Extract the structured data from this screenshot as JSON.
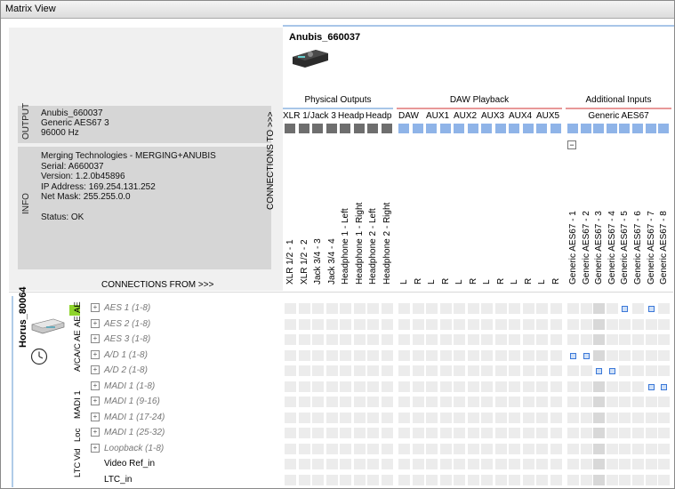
{
  "window": {
    "title": "Matrix View"
  },
  "output_panel": {
    "section_label": "OUTPUT",
    "name": "Anubis_660037",
    "type": "Generic AES67 3",
    "rate": "96000 Hz"
  },
  "info_panel": {
    "section_label": "INFO",
    "lines": [
      "Merging Technologies - MERGING+ANUBIS",
      "Serial: A660037",
      "Version: 1.2.0b45896",
      "IP Address: 169.254.131.252",
      "Net Mask: 255.255.0.0",
      "",
      "Status: OK"
    ]
  },
  "connections_from": "CONNECTIONS FROM >>>",
  "connections_to": "CONNECTIONS TO >>>",
  "target_device": {
    "name": "Anubis_660037"
  },
  "groups": [
    {
      "label": "Physical Outputs",
      "accent": "#a8c6e8"
    },
    {
      "label": "DAW Playback",
      "accent": "#e89898"
    },
    {
      "label": "Additional Inputs",
      "accent": "#e89898"
    }
  ],
  "subgroups": [
    "XLR 1/",
    "Jack 3",
    "Headp",
    "Headp",
    "DAW",
    "AUX1",
    "AUX2",
    "AUX3",
    "AUX4",
    "AUX5",
    "Generic AES67"
  ],
  "columns": [
    "XLR 1/2 - 1",
    "XLR 1/2 - 2",
    "Jack 3/4 - 3",
    "Jack 3/4 - 4",
    "Headphone 1 - Left",
    "Headphone 1 - Right",
    "Headphone 2 - Left",
    "Headphone 2 - Right",
    "L",
    "R",
    "L",
    "R",
    "L",
    "R",
    "L",
    "R",
    "L",
    "R",
    "L",
    "R",
    "Generic AES67 - 1",
    "Generic AES67 - 2",
    "Generic AES67 - 3",
    "Generic AES67 - 4",
    "Generic AES67 - 5",
    "Generic AES67 - 6",
    "Generic AES67 - 7",
    "Generic AES67 - 8"
  ],
  "source_device": {
    "name": "Horus_80064",
    "status_color": "#8ed42b"
  },
  "source_groups": [
    "AE",
    "AE",
    "AE",
    "A/C",
    "A/C",
    "MADI 1",
    "Loc",
    "Vid",
    "LTC"
  ],
  "rows": [
    {
      "label": "AES 1 (1-8)",
      "expandable": true
    },
    {
      "label": "AES 2 (1-8)",
      "expandable": true
    },
    {
      "label": "AES 3 (1-8)",
      "expandable": true
    },
    {
      "label": "A/D 1 (1-8)",
      "expandable": true
    },
    {
      "label": "A/D 2 (1-8)",
      "expandable": true
    },
    {
      "label": "MADI 1 (1-8)",
      "expandable": true
    },
    {
      "label": "MADI 1 (9-16)",
      "expandable": true
    },
    {
      "label": "MADI 1 (17-24)",
      "expandable": true
    },
    {
      "label": "MADI 1 (25-32)",
      "expandable": true
    },
    {
      "label": "Loopback (1-8)",
      "expandable": true
    },
    {
      "label": "Video Ref_in",
      "expandable": false
    },
    {
      "label": "LTC_in",
      "expandable": false
    }
  ],
  "connections": [
    {
      "row": 0,
      "col": 24
    },
    {
      "row": 0,
      "col": 26
    },
    {
      "row": 3,
      "col": 20
    },
    {
      "row": 3,
      "col": 21
    },
    {
      "row": 4,
      "col": 22
    },
    {
      "row": 4,
      "col": 23
    },
    {
      "row": 5,
      "col": 26
    },
    {
      "row": 5,
      "col": 27
    }
  ],
  "colors": {
    "physical_square": "#6e6e6e",
    "daw_square": "#8fb4e8",
    "aes_square": "#8fb4e8"
  }
}
